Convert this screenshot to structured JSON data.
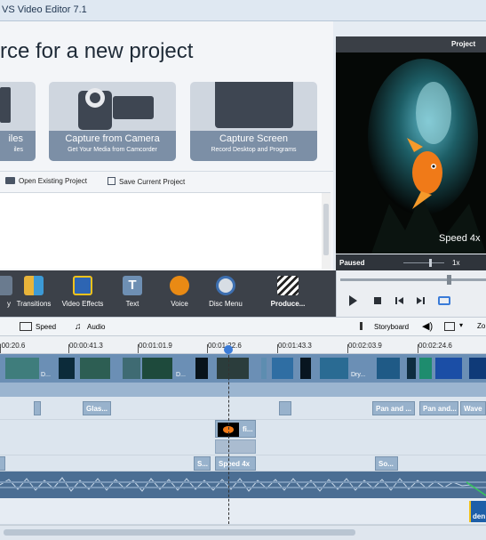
{
  "window": {
    "title": "VS Video Editor 7.1"
  },
  "start": {
    "headline": "rce for a new project",
    "tiles": [
      {
        "title": "iles",
        "subtitle": "iles",
        "icon": "files-icon"
      },
      {
        "title": "Capture from Camera",
        "subtitle": "Get Your Media from Camcorder",
        "icon": "camcorder-icon"
      },
      {
        "title": "Capture Screen",
        "subtitle": "Record Desktop and Programs",
        "icon": "monitor-icon"
      }
    ],
    "links": {
      "open": "Open Existing Project",
      "save": "Save Current Project"
    }
  },
  "preview": {
    "header": "Project",
    "overlay_text": "Speed 4x",
    "status": "Paused",
    "speed": "1x"
  },
  "toolbar": {
    "items": [
      {
        "label": "y",
        "icon": "effects-icon"
      },
      {
        "label": "Transitions",
        "icon": "transitions-icon"
      },
      {
        "label": "Video Effects",
        "icon": "video-effects-icon"
      },
      {
        "label": "Text",
        "icon": "text-icon"
      },
      {
        "label": "Voice",
        "icon": "microphone-icon"
      },
      {
        "label": "Disc Menu",
        "icon": "disc-menu-icon"
      },
      {
        "label": "Produce...",
        "icon": "clapperboard-icon"
      }
    ]
  },
  "timeline_controls": {
    "speed": "Speed",
    "audio": "Audio",
    "storyboard": "Storyboard",
    "zoom": "Zo"
  },
  "ruler": {
    "ticks": [
      "0:00:20.6",
      "00:00:41.3",
      "00:01:01.9",
      "00:01:22.6",
      "00:01:43.3",
      "00:02:03.9",
      "00:02:24.6"
    ]
  },
  "tracks": {
    "video_labels": [
      "D...",
      "D...",
      "Dry..."
    ],
    "transitions": [
      "Glas...",
      "Pan and ...",
      "Pan and...",
      "Wave"
    ],
    "overlay": [
      "fi..."
    ],
    "text": [
      "S...",
      "Speed 4x",
      "So..."
    ],
    "audio_end": "den"
  },
  "colors": {
    "accent": "#3a7bd8",
    "track": "#6b8fb5",
    "toolbar": "#3c4149"
  }
}
